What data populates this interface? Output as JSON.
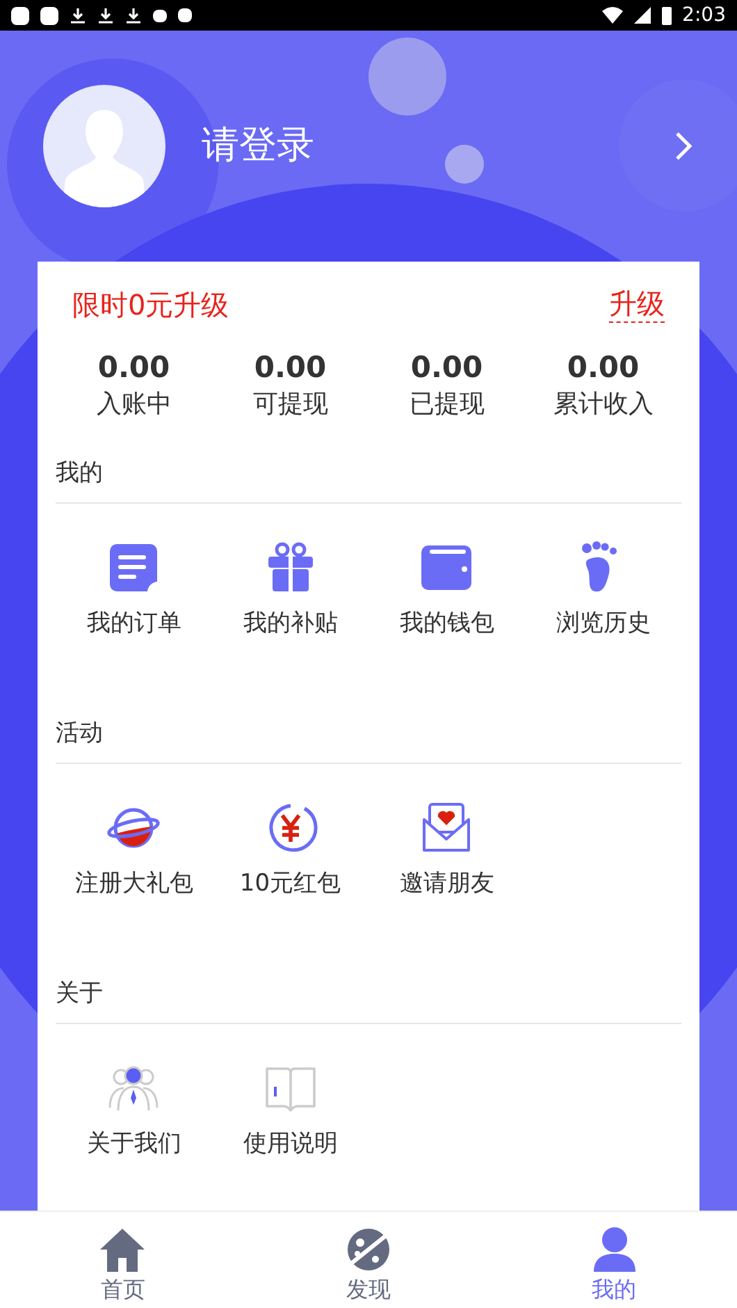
{
  "status_bar": {
    "time": "2:03"
  },
  "profile": {
    "name": "请登录"
  },
  "promo": {
    "title": "限时0元升级",
    "action": "升级"
  },
  "stats": [
    {
      "value": "0.00",
      "label": "入账中"
    },
    {
      "value": "0.00",
      "label": "可提现"
    },
    {
      "value": "0.00",
      "label": "已提现"
    },
    {
      "value": "0.00",
      "label": "累计收入"
    }
  ],
  "sections": [
    {
      "title": "我的",
      "items": [
        {
          "kind": "order",
          "label": "我的订单"
        },
        {
          "kind": "gift",
          "label": "我的补贴"
        },
        {
          "kind": "wallet",
          "label": "我的钱包"
        },
        {
          "kind": "footprint",
          "label": "浏览历史"
        }
      ]
    },
    {
      "title": "活动",
      "items": [
        {
          "kind": "planet",
          "label": "注册大礼包"
        },
        {
          "kind": "yuan",
          "label": "10元红包"
        },
        {
          "kind": "envelope",
          "label": "邀请朋友"
        }
      ]
    },
    {
      "title": "关于",
      "items": [
        {
          "kind": "people",
          "label": "关于我们"
        },
        {
          "kind": "book",
          "label": "使用说明"
        }
      ]
    }
  ],
  "tabs": [
    {
      "kind": "home",
      "label": "首页",
      "selected": false
    },
    {
      "kind": "discover",
      "label": "发现",
      "selected": false
    },
    {
      "kind": "me",
      "label": "我的",
      "selected": true
    }
  ]
}
